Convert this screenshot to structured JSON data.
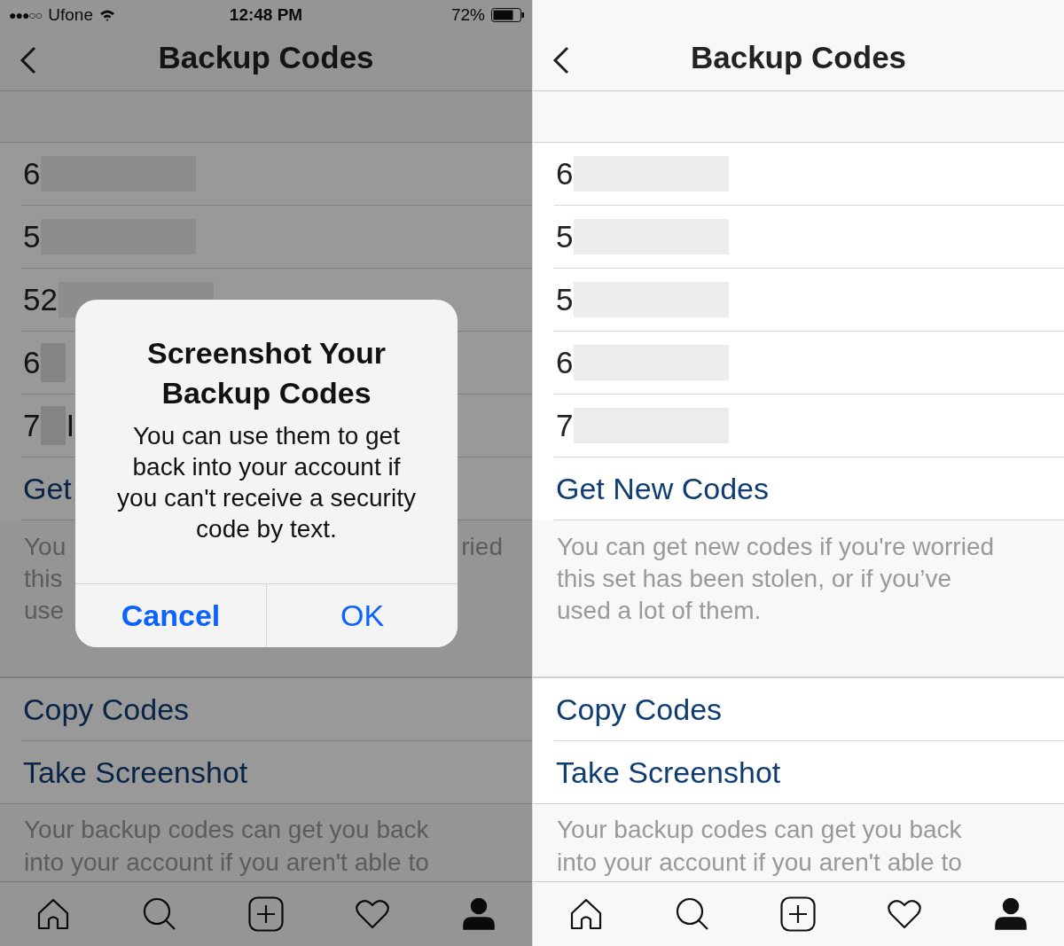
{
  "screens": [
    {
      "status_bar": {
        "signal": "●●●○○",
        "carrier": "Ufone",
        "time": "12:48 PM",
        "battery": "72%"
      },
      "title": "Backup Codes",
      "dimmed": true,
      "codes": [
        {
          "text": "6"
        },
        {
          "text": "5"
        },
        {
          "text": "52"
        },
        {
          "text": "6",
          "kind": "narrow"
        },
        {
          "text": "7",
          "kind": "narrow",
          "suffix": "I"
        }
      ],
      "get_new_codes": "Get",
      "info_lines": [
        {
          "left": "You",
          "right": "ried"
        },
        {
          "left": "this"
        },
        {
          "left": "use"
        }
      ],
      "copy_codes": "Copy Codes",
      "take_screenshot": "Take Screenshot",
      "footer": "Your backup codes can get you back into your account if you aren't able to",
      "tabs": [
        {
          "kind": "home",
          "selected": false
        },
        {
          "kind": "search",
          "selected": false
        },
        {
          "kind": "add",
          "selected": false
        },
        {
          "kind": "activity",
          "selected": false
        },
        {
          "kind": "profile",
          "selected": true
        }
      ],
      "alert": {
        "title": "Screenshot Your Backup Codes",
        "message": "You can use them to get back into your account if you can't receive a security code by text.",
        "buttons": [
          {
            "label": "Cancel",
            "kind": "cancel"
          },
          {
            "label": "OK",
            "kind": "default"
          }
        ]
      }
    },
    {
      "title": "Backup Codes",
      "codes": [
        {
          "text": "6"
        },
        {
          "text": "5"
        },
        {
          "text": "5"
        },
        {
          "text": "6"
        },
        {
          "text": "7"
        }
      ],
      "get_new_codes": "Get New Codes",
      "info": "You can get new codes if you're worried this set has been stolen, or if you’ve used a lot of them.",
      "copy_codes": "Copy Codes",
      "take_screenshot": "Take Screenshot",
      "footer": "Your backup codes can get you back into your account if you aren't able to",
      "tabs": [
        {
          "kind": "home",
          "selected": false
        },
        {
          "kind": "search",
          "selected": false
        },
        {
          "kind": "add",
          "selected": false
        },
        {
          "kind": "activity",
          "selected": false
        },
        {
          "kind": "profile",
          "selected": true
        }
      ]
    }
  ]
}
